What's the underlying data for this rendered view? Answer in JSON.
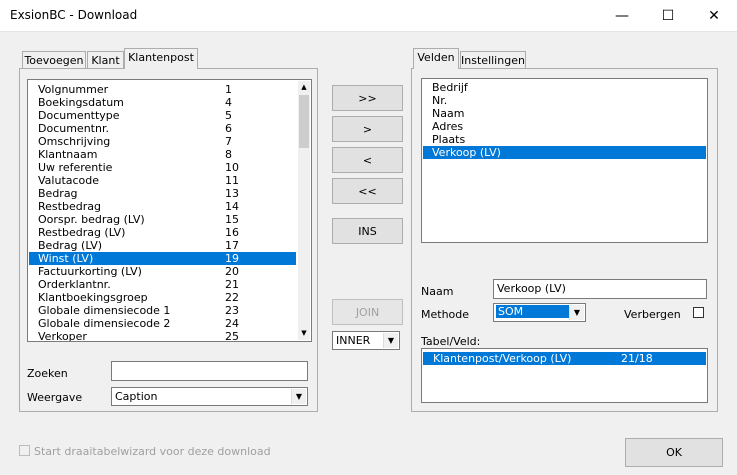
{
  "window": {
    "title": "ExsionBC - Download",
    "minimize": "—",
    "maximize": "☐",
    "close": "✕"
  },
  "left_tabs": [
    "Toevoegen",
    "Klant",
    "Klantenpost"
  ],
  "field_list": [
    {
      "label": "Volgnummer",
      "num": "1"
    },
    {
      "label": "Boekingsdatum",
      "num": "4"
    },
    {
      "label": "Documenttype",
      "num": "5"
    },
    {
      "label": "Documentnr.",
      "num": "6"
    },
    {
      "label": "Omschrijving",
      "num": "7"
    },
    {
      "label": "Klantnaam",
      "num": "8"
    },
    {
      "label": "Uw referentie",
      "num": "10"
    },
    {
      "label": "Valutacode",
      "num": "11"
    },
    {
      "label": "Bedrag",
      "num": "13"
    },
    {
      "label": "Restbedrag",
      "num": "14"
    },
    {
      "label": "Oorspr. bedrag (LV)",
      "num": "15"
    },
    {
      "label": "Restbedrag (LV)",
      "num": "16"
    },
    {
      "label": "Bedrag (LV)",
      "num": "17"
    },
    {
      "label": "Winst (LV)",
      "num": "19",
      "selected": true
    },
    {
      "label": "Factuurkorting (LV)",
      "num": "20"
    },
    {
      "label": "Orderklantnr.",
      "num": "21"
    },
    {
      "label": "Klantboekingsgroep",
      "num": "22"
    },
    {
      "label": "Globale dimensiecode 1",
      "num": "23"
    },
    {
      "label": "Globale dimensiecode 2",
      "num": "24"
    },
    {
      "label": "Verkoper",
      "num": "25"
    }
  ],
  "search": {
    "label": "Zoeken",
    "value": ""
  },
  "display": {
    "label": "Weergave",
    "value": "Caption"
  },
  "buttons": {
    "add_all": ">>",
    "add": ">",
    "remove": "<",
    "remove_all": "<<",
    "ins": "INS",
    "join": "JOIN",
    "join_type": "INNER",
    "ok": "OK"
  },
  "right_tabs": [
    "Velden",
    "Instellingen"
  ],
  "selected_fields": [
    {
      "label": "Bedrijf"
    },
    {
      "label": "Nr."
    },
    {
      "label": "Naam"
    },
    {
      "label": "Adres"
    },
    {
      "label": "Plaats"
    },
    {
      "label": "Verkoop (LV)",
      "selected": true
    }
  ],
  "props": {
    "naam_label": "Naam",
    "naam_value": "Verkoop (LV)",
    "methode_label": "Methode",
    "methode_value": "SOM",
    "verbergen_label": "Verbergen",
    "tabel_label": "Tabel/Veld:",
    "tabel_row_name": "Klantenpost/Verkoop (LV)",
    "tabel_row_num": "21/18"
  },
  "footer": {
    "wizard_label": "Start draaitabelwizard voor deze download"
  }
}
